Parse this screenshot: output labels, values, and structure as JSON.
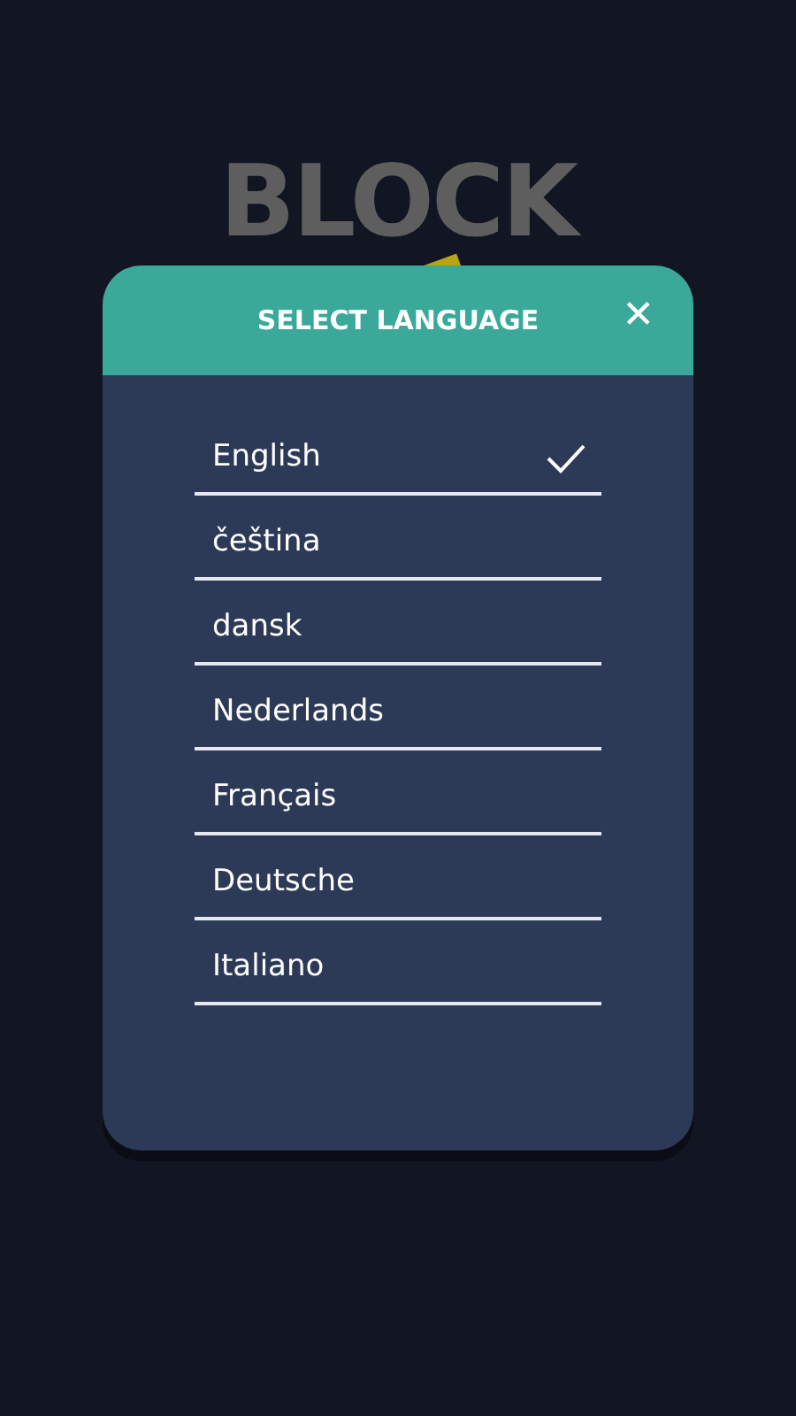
{
  "background_logo": {
    "title": "BLOCK"
  },
  "dialog": {
    "title": "SELECT LANGUAGE",
    "close": "✕",
    "languages": [
      {
        "label": "English",
        "selected": true
      },
      {
        "label": "čeština",
        "selected": false
      },
      {
        "label": "dansk",
        "selected": false
      },
      {
        "label": "Nederlands",
        "selected": false
      },
      {
        "label": "Français",
        "selected": false
      },
      {
        "label": "Deutsche",
        "selected": false
      },
      {
        "label": "Italiano",
        "selected": false
      }
    ]
  }
}
